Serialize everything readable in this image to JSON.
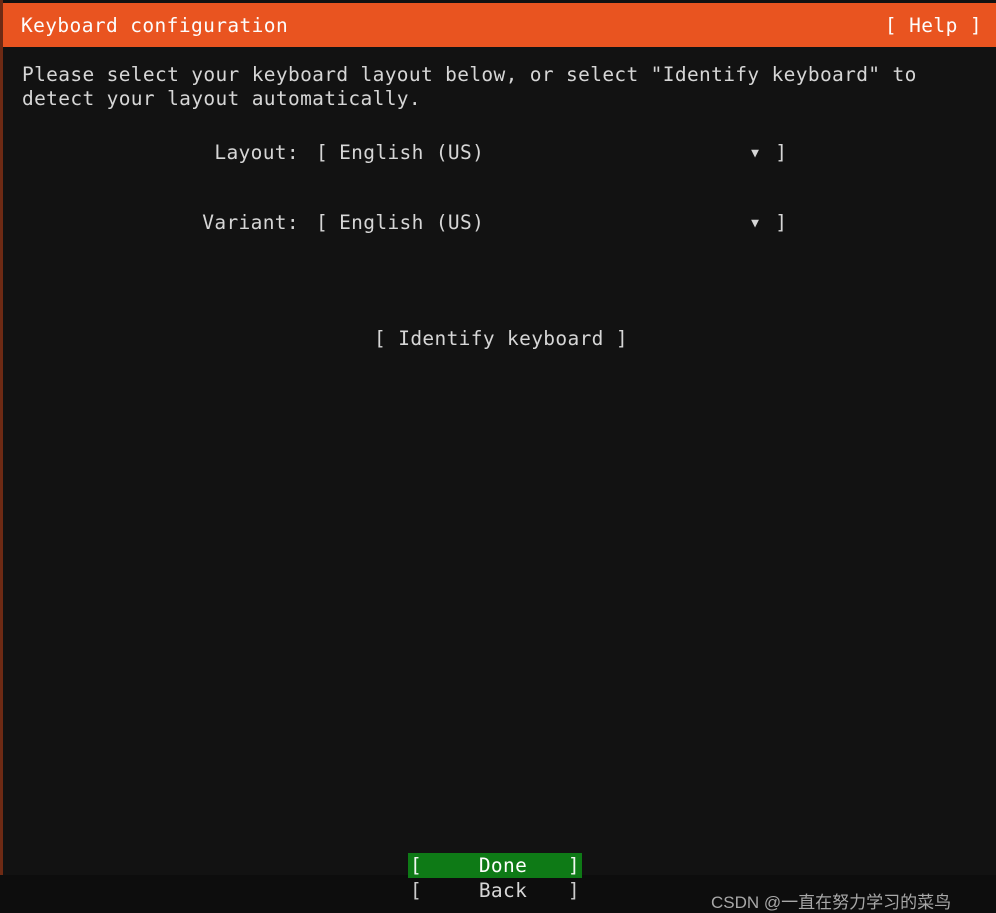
{
  "header": {
    "title": "Keyboard configuration",
    "help_label": "[ Help ]",
    "background_color": "#e95420",
    "text_color": "#fdfdfd"
  },
  "body": {
    "intro_text": "Please select your keyboard layout below, or select \"Identify keyboard\" to detect your layout automatically.",
    "background_color": "#121212",
    "text_color": "#d6d6d6"
  },
  "form": {
    "layout": {
      "label": "Layout:",
      "bracket_open": "[",
      "value": "English (US)",
      "caret": "▼",
      "bracket_close": "]"
    },
    "variant": {
      "label": "Variant:",
      "bracket_open": "[",
      "value": "English (US)",
      "caret": "▼",
      "bracket_close": "]"
    }
  },
  "identify_button": {
    "label": "[ Identify keyboard ]"
  },
  "footer": {
    "buttons": [
      {
        "bracket_open": "[",
        "label": "Done",
        "bracket_close": "]",
        "selected": true,
        "highlight_color": "#0e7a16"
      },
      {
        "bracket_open": "[",
        "label": "Back",
        "bracket_close": "]",
        "selected": false,
        "highlight_color": ""
      }
    ]
  },
  "watermark": {
    "text": "CSDN @一直在努力学习的菜鸟"
  }
}
